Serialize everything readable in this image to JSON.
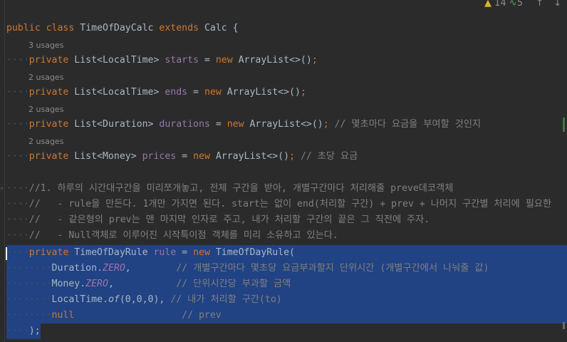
{
  "editor": {
    "status": {
      "warnings_count": "14",
      "weak_warnings_count": "5",
      "up_arrow": "↑",
      "down_arrow": "↓"
    },
    "class_decl": {
      "kw_public": "public",
      "kw_class": "class",
      "name": "TimeOfDayCalc",
      "kw_extends": "extends",
      "parent": "Calc",
      "brace": " {"
    },
    "hints": [
      "3 usages",
      "2 usages",
      "2 usages",
      "2 usages"
    ],
    "fields": [
      {
        "type": "List<LocalTime>",
        "name": "starts",
        "init": "ArrayList<>()",
        "comment": ""
      },
      {
        "type": "List<LocalTime>",
        "name": "ends",
        "init": "ArrayList<>()",
        "comment": ""
      },
      {
        "type": "List<Duration>",
        "name": "durations",
        "init": "ArrayList<>()",
        "comment": "// 몇초마다 요금을 부여할 것인지"
      },
      {
        "type": "List<Money>",
        "name": "prices",
        "init": "ArrayList<>()",
        "comment": "// 초당 요금"
      }
    ],
    "keywords": {
      "private": "private",
      "new": "new",
      "eq": " = ",
      "semi": ";"
    },
    "doc_comments": [
      "//1. 하루의 시간대구간을 미리쪼개놓고, 전체 구간을 받아, 개별구간마다 처리해줄 preve데코객체",
      "//   - rule을 만든다. 1개만 가지면 된다. start는 없이 end(처리할 구간) + prev + 나머지 구간별 처리에 필요한",
      "//   - 같은형의 prev는 맨 마지막 인자로 주고, 내가 처리할 구간의 끝은 그 직전에 주자.",
      "//   - Null객체로 이루어진 시작특이점 객체를 미리 소유하고 있는다."
    ],
    "rule_decl": {
      "type": "TimeOfDayRule",
      "name": "rule",
      "ctor": "TimeOfDayRule("
    },
    "args": [
      {
        "prefix": "Duration.",
        "value": "ZERO",
        "suffix": ",",
        "comment": "// 개별구간마다 몇초당 요금부과할지 단위시간 (개별구간에서 나눠줄 값)"
      },
      {
        "prefix": "Money.",
        "value": "ZERO",
        "suffix": ",",
        "comment": "// 단위시간당 부과할 금액"
      },
      {
        "prefix": "LocalTime.",
        "value": "of",
        "suffix": "(0,0,0),",
        "comment": "// 내가 처리할 구간(to)"
      },
      {
        "prefix": "null",
        "value": "",
        "suffix": "",
        "comment": "// prev"
      }
    ],
    "closing": ");"
  }
}
